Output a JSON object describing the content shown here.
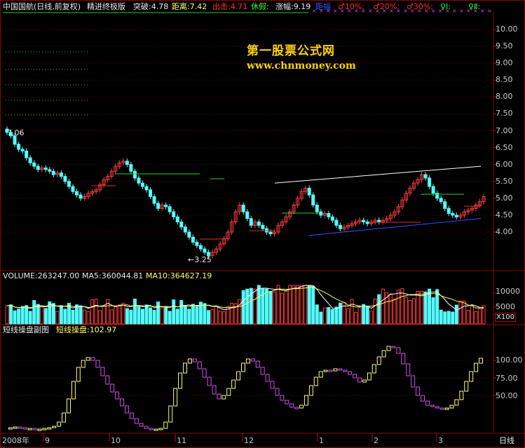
{
  "header": {
    "title": "中国国航(日线,前复权)",
    "indicator": "精进终极版",
    "breakout_label": "突破:4.78",
    "distance_label": "距离:7.42",
    "exit_label": "出击:4.71",
    "fake_label": "休假:",
    "rise_label": "涨幅:9.19",
    "distance2_label": "距幅",
    "pct10": "♂10%:",
    "pct20": "♂20%:",
    "pct30": "♂30%:",
    "level1": "♀Ⅰ:",
    "level2": "♀Ⅱ:"
  },
  "watermark": {
    "name": "第一股票公式网",
    "url": "www.chnmoney.com"
  },
  "price_axis": [
    "10.00",
    "9.50",
    "9.00",
    "8.50",
    "8.00",
    "7.50",
    "7.00",
    "6.50",
    "6.00",
    "5.50",
    "5.00",
    "4.50",
    "4.00"
  ],
  "annotations": {
    "high": "7.06",
    "low": "←3.25"
  },
  "volume_panel": {
    "vol_label": "VOLUME:263247.00",
    "ma5_label": "MA5:360044.81",
    "ma10_label": "MA10:364627.19",
    "axis": [
      "10000",
      "5000"
    ],
    "unit": "X100"
  },
  "osc_panel": {
    "title": "短线操盘副图",
    "value_label": "短线操盘:102.97",
    "axis": [
      "100.00",
      "75.00",
      "50.00"
    ]
  },
  "time_axis": {
    "labels": [
      "2008年",
      "9",
      "10",
      "11",
      "12",
      "1",
      "2",
      "3"
    ],
    "period": "日线"
  },
  "colors": {
    "up": "#ff3c3c",
    "down": "#54fcfc",
    "grid": "#8b0000",
    "osc_up": "#ffff80",
    "osc_down": "#d050f0"
  },
  "chart_data": {
    "type": "candlestick",
    "price_closes": [
      6.95,
      6.85,
      6.6,
      6.45,
      6.4,
      6.2,
      6.05,
      5.95,
      5.85,
      5.9,
      5.85,
      5.8,
      5.7,
      5.75,
      5.65,
      5.5,
      5.35,
      5.2,
      5.1,
      5.0,
      5.05,
      5.15,
      5.2,
      5.25,
      5.4,
      5.55,
      5.65,
      5.8,
      5.95,
      6.05,
      6.1,
      6.0,
      5.8,
      5.6,
      5.45,
      5.35,
      5.25,
      5.05,
      4.85,
      4.7,
      4.8,
      4.75,
      4.6,
      4.45,
      4.3,
      4.15,
      4.0,
      3.85,
      3.7,
      3.6,
      3.5,
      3.4,
      3.3,
      3.4,
      3.5,
      3.65,
      3.8,
      4.0,
      4.3,
      4.6,
      4.8,
      4.6,
      4.4,
      4.2,
      4.3,
      4.2,
      4.1,
      4.0,
      3.95,
      4.0,
      4.2,
      4.3,
      4.45,
      4.6,
      4.8,
      5.0,
      5.2,
      5.3,
      5.1,
      4.8,
      4.6,
      4.5,
      4.55,
      4.45,
      4.35,
      4.2,
      4.1,
      4.15,
      4.2,
      4.25,
      4.3,
      4.35,
      4.3,
      4.25,
      4.3,
      4.35,
      4.3,
      4.35,
      4.4,
      4.5,
      4.6,
      4.75,
      4.95,
      5.15,
      5.3,
      5.45,
      5.55,
      5.7,
      5.6,
      5.35,
      5.15,
      5.0,
      4.9,
      4.7,
      4.55,
      4.5,
      4.45,
      4.5,
      4.6,
      4.65,
      4.7,
      4.8,
      4.9,
      5.05
    ],
    "volume_ma": {
      "MA5": 360044.81,
      "MA10": 364627.19,
      "VOLUME": 263247.0
    },
    "osc_values": [
      2,
      4,
      5,
      4,
      3,
      3,
      2,
      2,
      3,
      4,
      6,
      12,
      25,
      45,
      70,
      90,
      100,
      104,
      100,
      90,
      78,
      66,
      55,
      45,
      35,
      25,
      17,
      10,
      6,
      3,
      2,
      2,
      3,
      12,
      35,
      60,
      82,
      96,
      102,
      98,
      88,
      76,
      64,
      52,
      45,
      50,
      60,
      72,
      84,
      96,
      102,
      99,
      90,
      80,
      70,
      60,
      50,
      43,
      38,
      33,
      32,
      36,
      50,
      64,
      76,
      84,
      86,
      85,
      88,
      86,
      84,
      80,
      75,
      69,
      72,
      82,
      94,
      105,
      114,
      120,
      118,
      110,
      95,
      78,
      62,
      50,
      42,
      36,
      34,
      32,
      30,
      32,
      36,
      44,
      56,
      70,
      84,
      96,
      103
    ]
  }
}
